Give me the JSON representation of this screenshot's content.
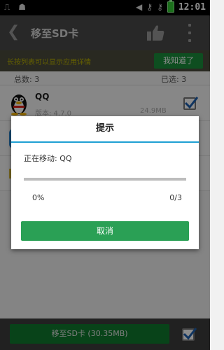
{
  "status_bar": {
    "time": "12:01"
  },
  "title_bar": {
    "title": "移至SD卡"
  },
  "tip_bar": {
    "tip": "长按列表可以显示应用详情",
    "dismiss_label": "我知道了"
  },
  "counts": {
    "total_label": "总数: 3",
    "selected_label": "已选: 3"
  },
  "apps": [
    {
      "name": "QQ",
      "version": "版本: 4.7.0",
      "size": "24.9MB",
      "checked": true
    },
    {
      "name": "",
      "version": "",
      "size": "",
      "checked": true
    },
    {
      "name": "",
      "version": "",
      "size": "",
      "checked": true
    }
  ],
  "dialog": {
    "title": "提示",
    "moving_text": "正在移动: QQ",
    "percent_text": "0%",
    "fraction_text": "0/3",
    "progress": 0,
    "cancel_label": "取消"
  },
  "bottom_bar": {
    "move_button_label": "移至SD卡 (30.35MB)",
    "select_all_checked": true
  },
  "colors": {
    "accent_green": "#2aa055",
    "dialog_divider": "#1ea0d3",
    "tip_text": "#b8b000"
  }
}
